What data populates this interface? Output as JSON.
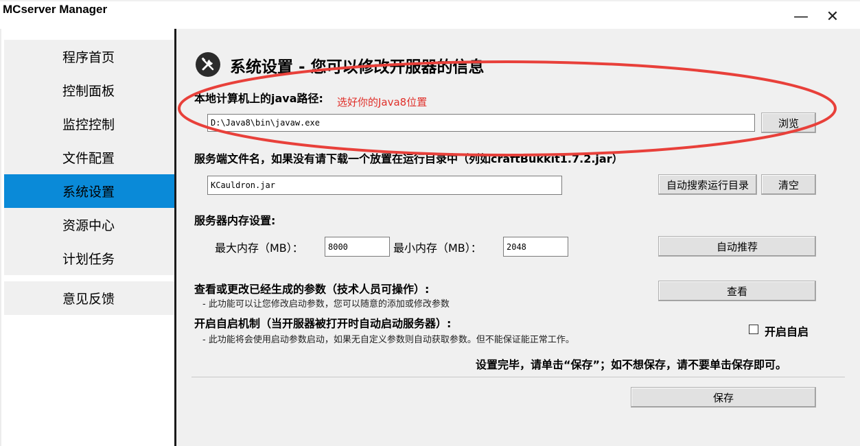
{
  "window": {
    "title": "MCserver Manager",
    "minimize_glyph": "—",
    "close_glyph": "✕"
  },
  "sidebar": {
    "items": [
      {
        "label": "程序首页"
      },
      {
        "label": "控制面板"
      },
      {
        "label": "监控控制"
      },
      {
        "label": "文件配置"
      },
      {
        "label": "系统设置",
        "active": true
      },
      {
        "label": "资源中心"
      },
      {
        "label": "计划任务"
      }
    ],
    "feedback": {
      "label": "意见反馈"
    }
  },
  "header": {
    "icon": "wrench-screwdriver-icon",
    "title": "系统设置 - 您可以修改开服器的信息"
  },
  "java": {
    "label": "本地计算机上的java路径:",
    "annotation": "选好你的Java8位置",
    "path_value": "D:\\Java8\\bin\\javaw.exe",
    "browse_label": "浏览"
  },
  "server_file": {
    "label": "服务端文件名，如果没有请下载一个放置在运行目录中（列如craftBukkit1.7.2.jar）",
    "value": "KCauldron.jar",
    "auto_search_label": "自动搜索运行目录",
    "clear_label": "清空"
  },
  "memory": {
    "label": "服务器内存设置:",
    "max_label": "最大内存（MB）：",
    "max_value": "8000",
    "min_label": "最小内存（MB）：",
    "min_value": "2048",
    "recommend_label": "自动推荐"
  },
  "params": {
    "label": "查看或更改已经生成的参数（技术人员可操作）:",
    "note": "- 此功能可以让您修改启动参数，您可以随意的添加或修改参数",
    "view_label": "查看"
  },
  "autostart": {
    "label": "开启自启机制（当开服器被打开时自动启动服务器）:",
    "note": "- 此功能将会使用启动参数启动，如果无自定义参数则自动获取参数。但不能保证能正常工作。",
    "checkbox_label": "开启自启",
    "checked": false
  },
  "footer": {
    "hint": "设置完毕，请单击“保存”；如不想保存，请不要单击保存即可。",
    "save_label": "保存"
  },
  "colors": {
    "accent": "#0a8ad8",
    "annotation_red": "#e8403a"
  }
}
